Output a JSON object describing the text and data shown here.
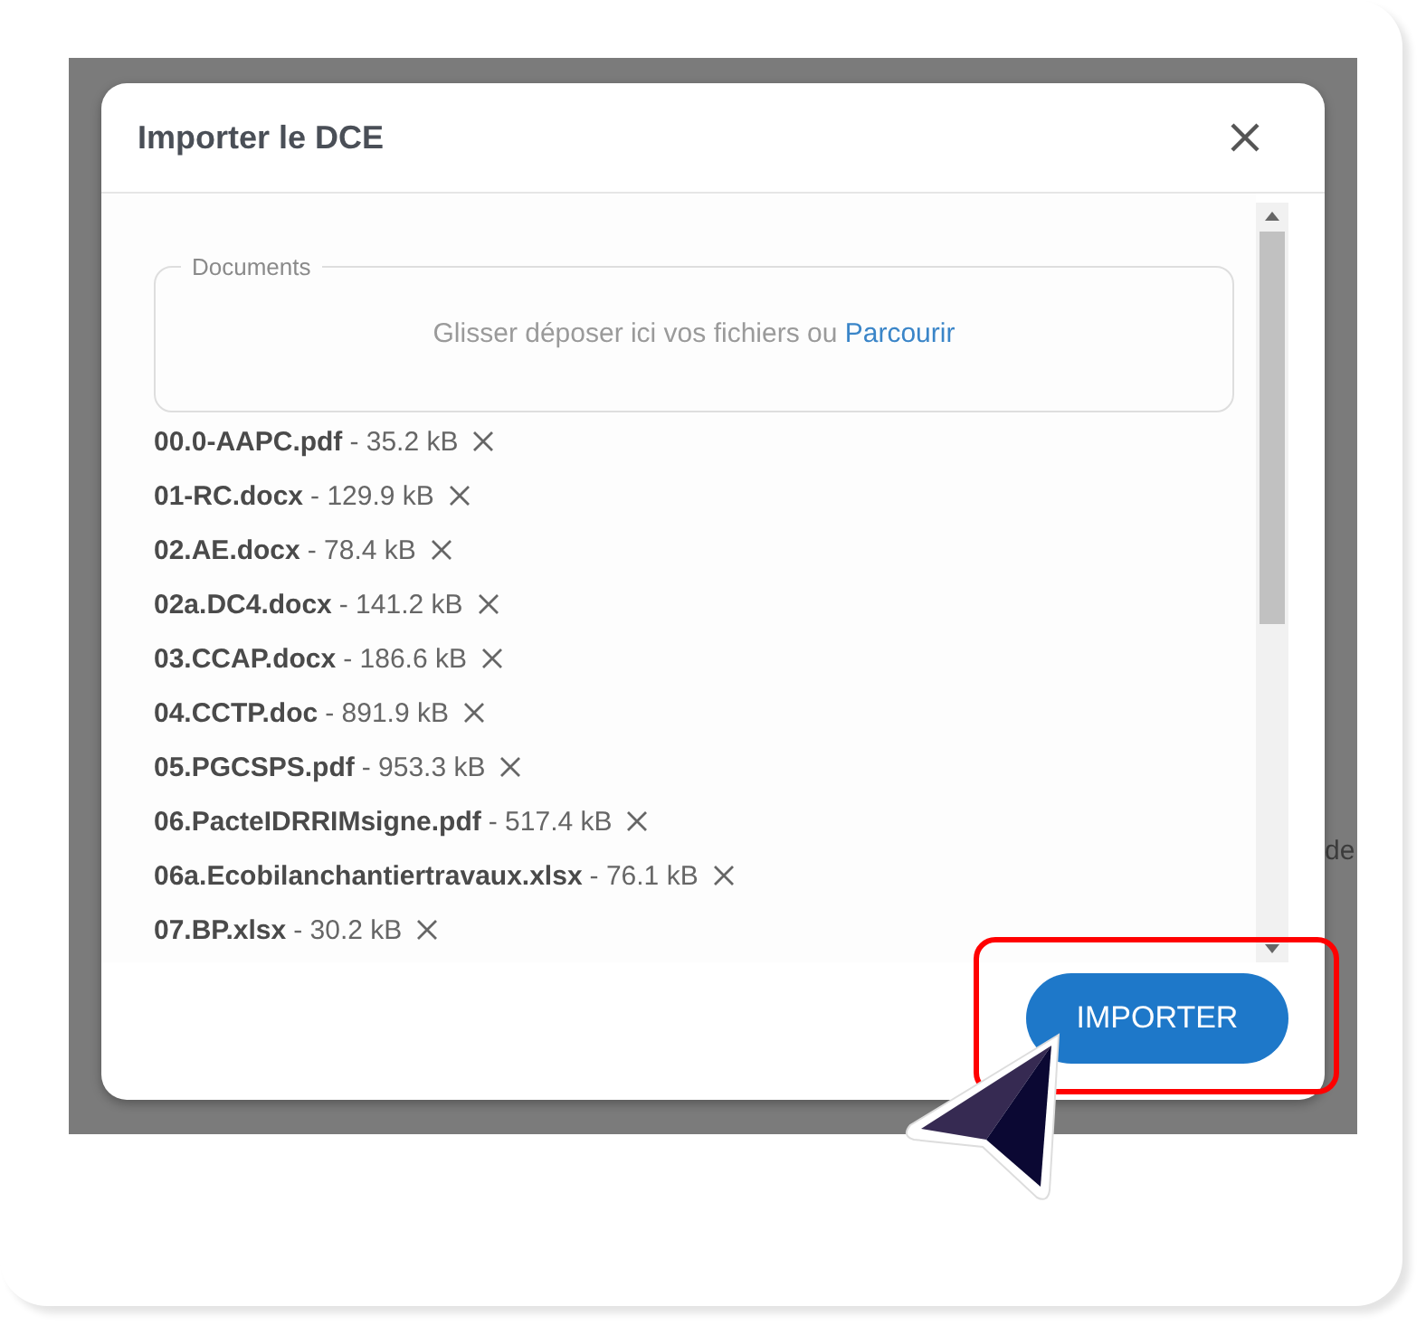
{
  "dialog": {
    "title": "Importer le DCE",
    "dropzone": {
      "legend": "Documents",
      "hint": "Glisser déposer ici vos fichiers ou",
      "link": "Parcourir"
    },
    "files": [
      {
        "name": "00.0-AAPC.pdf",
        "size": "- 35.2 kB"
      },
      {
        "name": "01-RC.docx",
        "size": "- 129.9 kB"
      },
      {
        "name": "02.AE.docx",
        "size": "- 78.4 kB"
      },
      {
        "name": "02a.DC4.docx",
        "size": "- 141.2 kB"
      },
      {
        "name": "03.CCAP.docx",
        "size": "- 186.6 kB"
      },
      {
        "name": "04.CCTP.doc",
        "size": "- 891.9 kB"
      },
      {
        "name": "05.PGCSPS.pdf",
        "size": "- 953.3 kB"
      },
      {
        "name": "06.PacteIDRRIMsigne.pdf",
        "size": "- 517.4 kB"
      },
      {
        "name": "06a.Ecobilanchantiertravaux.xlsx",
        "size": "- 76.1 kB"
      },
      {
        "name": "07.BP.xlsx",
        "size": "- 30.2 kB"
      }
    ],
    "button": "IMPORTER"
  },
  "background_text": "de"
}
